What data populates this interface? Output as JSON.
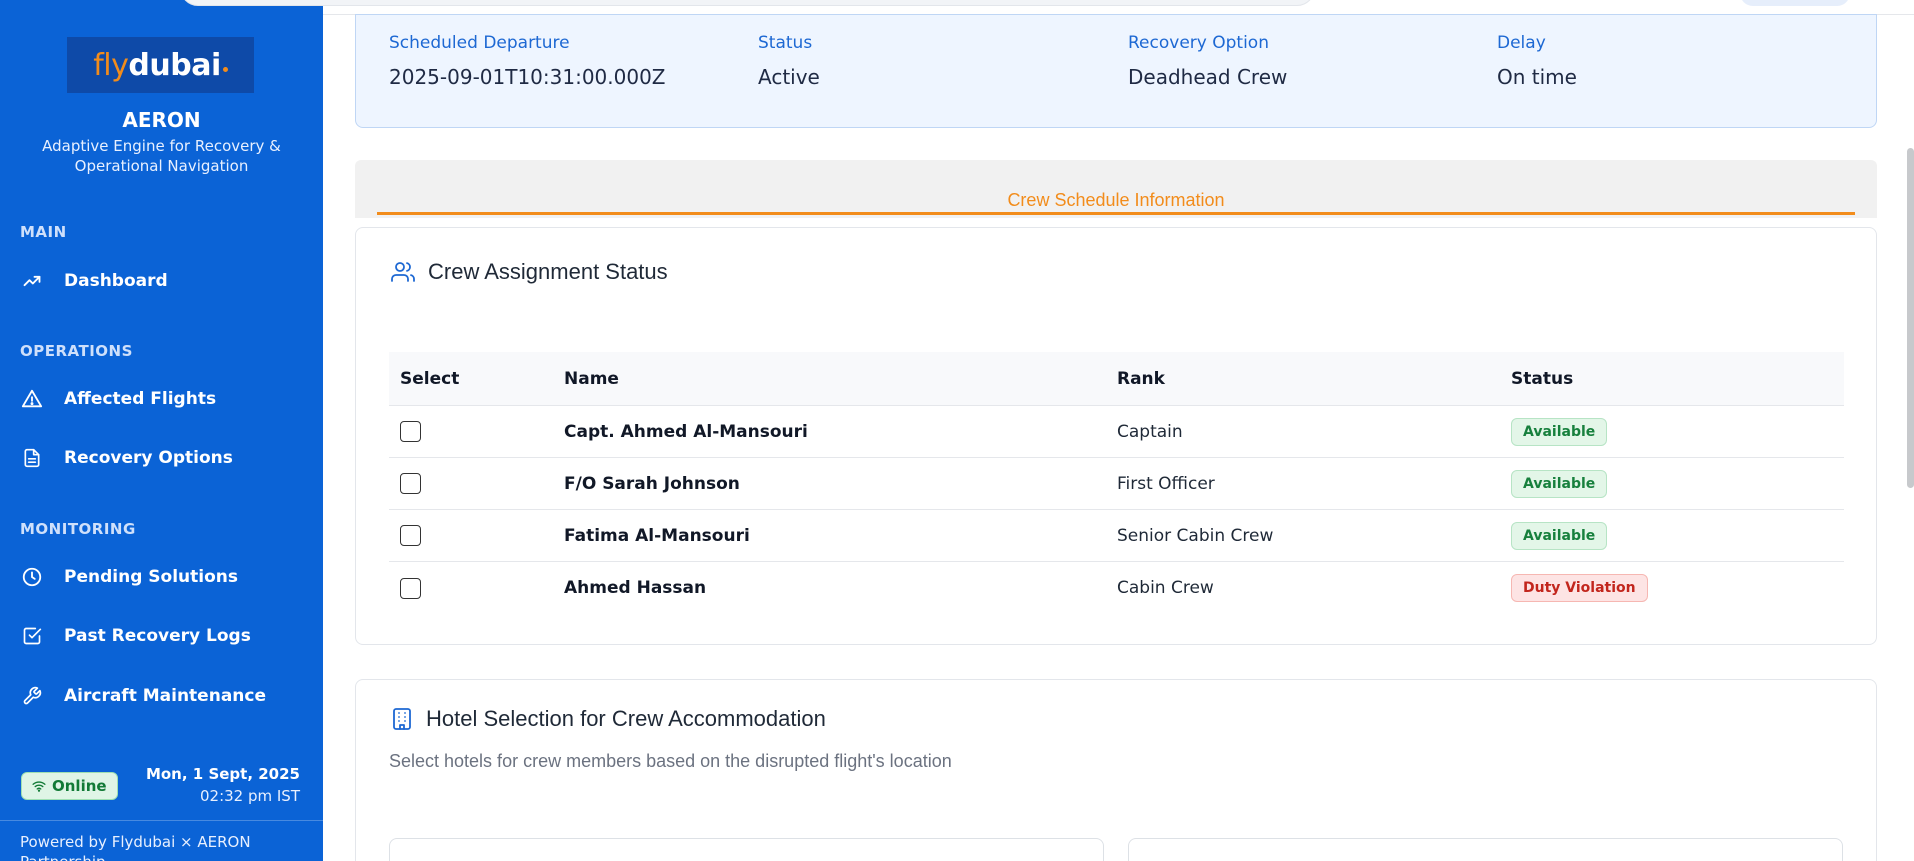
{
  "sidebar": {
    "logo_text_fly": "fly",
    "logo_text_dubai": "dubai",
    "brand_title": "AERON",
    "brand_subtitle": "Adaptive Engine for Recovery & Operational Navigation",
    "sections": {
      "main": "MAIN",
      "operations": "OPERATIONS",
      "monitoring": "MONITORING"
    },
    "items": {
      "dashboard": "Dashboard",
      "affected_flights": "Affected Flights",
      "recovery_options": "Recovery Options",
      "pending_solutions": "Pending Solutions",
      "past_recovery_logs": "Past Recovery Logs",
      "aircraft_maintenance": "Aircraft Maintenance"
    },
    "status": "Online",
    "date": "Mon, 1 Sept, 2025",
    "time": "02:32 pm IST",
    "powered_by": "Powered by Flydubai × AERON Partnership"
  },
  "flight_info": {
    "scheduled_departure_label": "Scheduled Departure",
    "scheduled_departure_value": "2025-09-01T10:31:00.000Z",
    "status_label": "Status",
    "status_value": "Active",
    "recovery_option_label": "Recovery Option",
    "recovery_option_value": "Deadhead Crew",
    "delay_label": "Delay",
    "delay_value": "On time"
  },
  "tab": {
    "label": "Crew Schedule Information"
  },
  "crew_panel": {
    "title": "Crew Assignment Status",
    "columns": [
      "Select",
      "Name",
      "Rank",
      "Status"
    ],
    "rows": [
      {
        "name": "Capt. Ahmed Al-Mansouri",
        "rank": "Captain",
        "status": "Available"
      },
      {
        "name": "F/O Sarah Johnson",
        "rank": "First Officer",
        "status": "Available"
      },
      {
        "name": "Fatima Al-Mansouri",
        "rank": "Senior Cabin Crew",
        "status": "Available"
      },
      {
        "name": "Ahmed Hassan",
        "rank": "Cabin Crew",
        "status": "Duty Violation"
      }
    ]
  },
  "hotel_panel": {
    "title": "Hotel Selection for Crew Accommodation",
    "subtitle": "Select hotels for crew members based on the disrupted flight's location"
  },
  "colors": {
    "sidebar_bg": "#0b63d6",
    "accent_orange": "#f28c1b",
    "label_blue": "#1d68d3",
    "available_green": "#17803d",
    "violation_red": "#c2261d"
  }
}
